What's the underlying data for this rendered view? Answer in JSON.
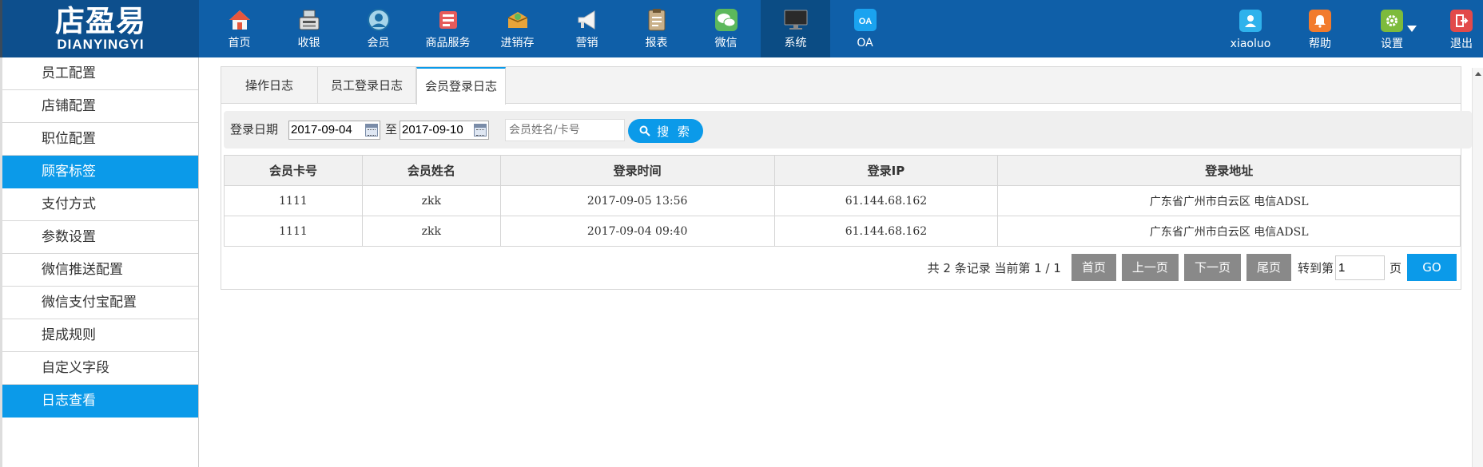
{
  "logo": {
    "cn": "店盈易",
    "en": "DIANYINGYI"
  },
  "nav": [
    {
      "label": "首页",
      "icon": "house-icon",
      "color": "#e6563c"
    },
    {
      "label": "收银",
      "icon": "cash-register-icon",
      "color": "#d7d7d7"
    },
    {
      "label": "会员",
      "icon": "member-icon",
      "color": "#a6d5ea"
    },
    {
      "label": "商品服务",
      "icon": "product-icon",
      "color": "#e65b5b"
    },
    {
      "label": "进销存",
      "icon": "inventory-icon",
      "color": "#e8a43a"
    },
    {
      "label": "营销",
      "icon": "megaphone-icon",
      "color": "#ffffff"
    },
    {
      "label": "报表",
      "icon": "report-icon",
      "color": "#c9b08a"
    },
    {
      "label": "微信",
      "icon": "wechat-icon",
      "color": "#5cb85c"
    },
    {
      "label": "系统",
      "icon": "monitor-icon",
      "color": "#2a2a2a",
      "active": true
    },
    {
      "label": "OA",
      "icon": "oa-icon",
      "color": "#1aa3f0"
    }
  ],
  "utils": {
    "user": {
      "label": "xiaoluo",
      "color": "#2fb2ec"
    },
    "help": {
      "label": "帮助",
      "color": "#f27b2d"
    },
    "settings": {
      "label": "设置",
      "color": "#7dbb3c"
    },
    "logout": {
      "label": "退出",
      "color": "#e24a4a"
    }
  },
  "sidebar": [
    {
      "label": "员工配置"
    },
    {
      "label": "店铺配置"
    },
    {
      "label": "职位配置"
    },
    {
      "label": "顾客标签",
      "active": true
    },
    {
      "label": "支付方式"
    },
    {
      "label": "参数设置"
    },
    {
      "label": "微信推送配置"
    },
    {
      "label": "微信支付宝配置"
    },
    {
      "label": "提成规则"
    },
    {
      "label": "自定义字段"
    },
    {
      "label": "日志查看",
      "active": true
    }
  ],
  "tabs": [
    {
      "label": "操作日志"
    },
    {
      "label": "员工登录日志"
    },
    {
      "label": "会员登录日志",
      "active": true
    }
  ],
  "filter": {
    "date_label": "登录日期",
    "start_date": "2017-09-04",
    "to_label": "至",
    "end_date": "2017-09-10",
    "search_placeholder": "会员姓名/卡号",
    "search_button": "搜 索"
  },
  "table": {
    "columns": [
      "会员卡号",
      "会员姓名",
      "登录时间",
      "登录IP",
      "登录地址"
    ],
    "rows": [
      [
        "1111",
        "zkk",
        "2017-09-05 13:56",
        "61.144.68.162",
        "广东省广州市白云区 电信ADSL"
      ],
      [
        "1111",
        "zkk",
        "2017-09-04 09:40",
        "61.144.68.162",
        "广东省广州市白云区 电信ADSL"
      ]
    ]
  },
  "pager": {
    "info": "共 2 条记录 当前第 1 / 1",
    "first": "首页",
    "prev": "上一页",
    "next": "下一页",
    "last": "尾页",
    "goto_label": "转到第",
    "page_value": "1",
    "page_unit": "页",
    "go": "GO"
  }
}
